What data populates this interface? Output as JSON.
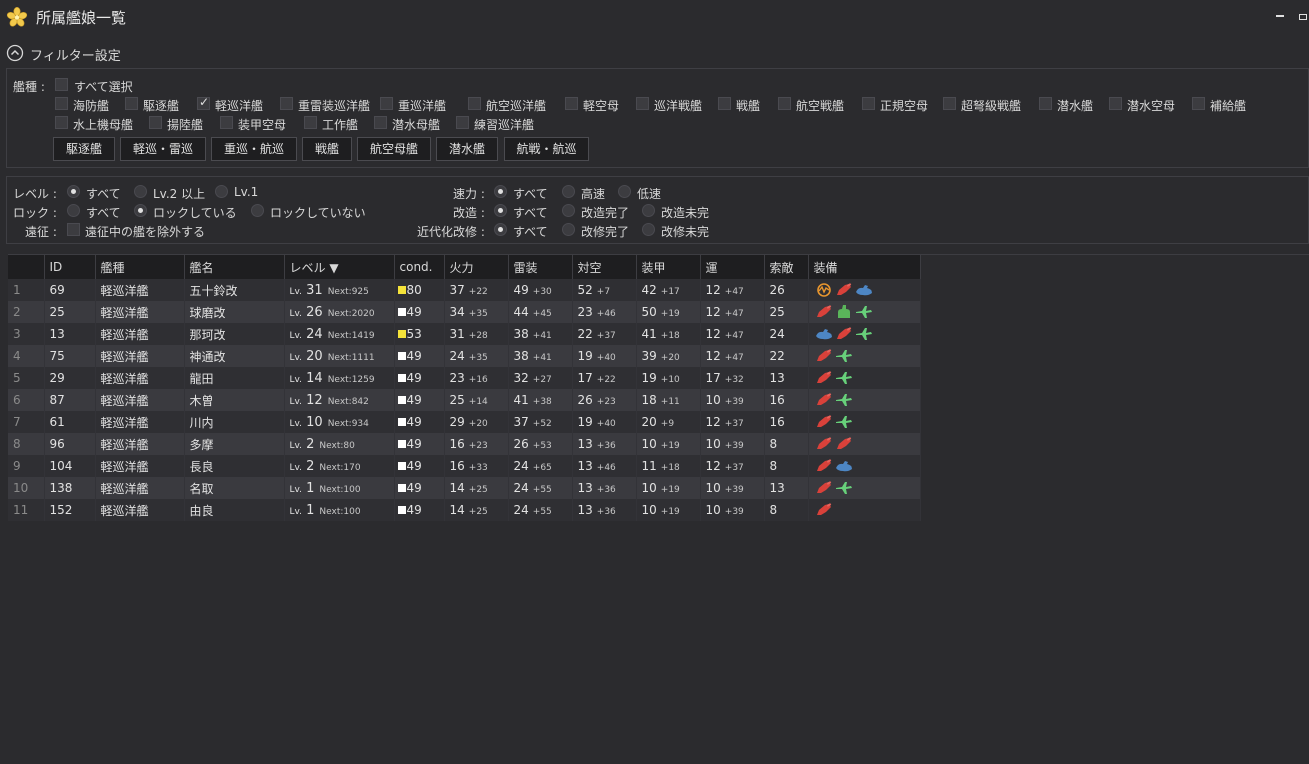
{
  "window": {
    "title": "所属艦娘一覧"
  },
  "filter": {
    "header": "フィルター設定",
    "type_label": "艦種 :",
    "select_all": "すべて選択",
    "types_row1": [
      "海防艦",
      "駆逐艦",
      "軽巡洋艦",
      "重雷装巡洋艦",
      "重巡洋艦",
      "航空巡洋艦",
      "軽空母",
      "巡洋戦艦",
      "戦艦",
      "航空戦艦",
      "正規空母",
      "超弩級戦艦",
      "潜水艦",
      "潜水空母",
      "補給艦"
    ],
    "types_row1_checked": [
      false,
      false,
      true,
      false,
      false,
      false,
      false,
      false,
      false,
      false,
      false,
      false,
      false,
      false,
      false
    ],
    "types_row2": [
      "水上機母艦",
      "揚陸艦",
      "装甲空母",
      "工作艦",
      "潜水母艦",
      "練習巡洋艦"
    ],
    "quick_buttons": [
      "駆逐艦",
      "軽巡・雷巡",
      "重巡・航巡",
      "戦艦",
      "航空母艦",
      "潜水艦",
      "航戦・航巡"
    ],
    "level": {
      "label": "レベル :",
      "options": [
        "すべて",
        "Lv.2 以上",
        "Lv.1"
      ],
      "selected": 0
    },
    "lock": {
      "label": "ロック :",
      "options": [
        "すべて",
        "ロックしている",
        "ロックしていない"
      ],
      "selected": 1
    },
    "expedition": {
      "label": "遠征 :",
      "text": "遠征中の艦を除外する"
    },
    "speed": {
      "label": "速力 :",
      "options": [
        "すべて",
        "高速",
        "低速"
      ],
      "selected": 0
    },
    "remodel": {
      "label": "改造 :",
      "options": [
        "すべて",
        "改造完了",
        "改造未完"
      ],
      "selected": 0
    },
    "modernize": {
      "label": "近代化改修 :",
      "options": [
        "すべて",
        "改修完了",
        "改修未完"
      ],
      "selected": 0
    }
  },
  "table": {
    "headers": [
      "",
      "ID",
      "艦種",
      "艦名",
      "レベル ▼",
      "cond.",
      "火力",
      "雷装",
      "対空",
      "装甲",
      "運",
      "索敵",
      "装備"
    ],
    "lv_prefix": "Lv.",
    "next_prefix": "Next:",
    "rows": [
      {
        "no": "1",
        "id": "69",
        "type": "軽巡洋艦",
        "name": "五十鈴改",
        "lv": "31",
        "next": "925",
        "cond": "80",
        "cond_color": "#f5e33a",
        "fire": "37",
        "fire_p": "+22",
        "torp": "49",
        "torp_p": "+30",
        "aa": "52",
        "aa_p": "+7",
        "armor": "42",
        "armor_p": "+17",
        "luck": "12",
        "luck_p": "+47",
        "los": "26",
        "equip": [
          "radar-icon",
          "gun-red-icon",
          "sonar-blue-icon"
        ]
      },
      {
        "no": "2",
        "id": "25",
        "type": "軽巡洋艦",
        "name": "球磨改",
        "lv": "26",
        "next": "2020",
        "cond": "49",
        "cond_color": "#ffffff",
        "fire": "34",
        "fire_p": "+35",
        "torp": "44",
        "torp_p": "+45",
        "aa": "23",
        "aa_p": "+46",
        "armor": "50",
        "armor_p": "+19",
        "luck": "12",
        "luck_p": "+47",
        "los": "25",
        "equip": [
          "gun-red-icon",
          "gun-green-icon",
          "seaplane-green-icon"
        ]
      },
      {
        "no": "3",
        "id": "13",
        "type": "軽巡洋艦",
        "name": "那珂改",
        "lv": "24",
        "next": "1419",
        "cond": "53",
        "cond_color": "#f5e33a",
        "fire": "31",
        "fire_p": "+28",
        "torp": "38",
        "torp_p": "+41",
        "aa": "22",
        "aa_p": "+37",
        "armor": "41",
        "armor_p": "+18",
        "luck": "12",
        "luck_p": "+47",
        "los": "24",
        "equip": [
          "sonar-blue-icon",
          "gun-red-icon",
          "seaplane-green-icon"
        ]
      },
      {
        "no": "4",
        "id": "75",
        "type": "軽巡洋艦",
        "name": "神通改",
        "lv": "20",
        "next": "1111",
        "cond": "49",
        "cond_color": "#ffffff",
        "fire": "24",
        "fire_p": "+35",
        "torp": "38",
        "torp_p": "+41",
        "aa": "19",
        "aa_p": "+40",
        "armor": "39",
        "armor_p": "+20",
        "luck": "12",
        "luck_p": "+47",
        "los": "22",
        "equip": [
          "gun-red-icon",
          "seaplane-green-icon"
        ]
      },
      {
        "no": "5",
        "id": "29",
        "type": "軽巡洋艦",
        "name": "龍田",
        "lv": "14",
        "next": "1259",
        "cond": "49",
        "cond_color": "#ffffff",
        "fire": "23",
        "fire_p": "+16",
        "torp": "32",
        "torp_p": "+27",
        "aa": "17",
        "aa_p": "+22",
        "armor": "19",
        "armor_p": "+10",
        "luck": "17",
        "luck_p": "+32",
        "los": "13",
        "equip": [
          "gun-red-icon",
          "seaplane-green-icon"
        ]
      },
      {
        "no": "6",
        "id": "87",
        "type": "軽巡洋艦",
        "name": "木曽",
        "lv": "12",
        "next": "842",
        "cond": "49",
        "cond_color": "#ffffff",
        "fire": "25",
        "fire_p": "+14",
        "torp": "41",
        "torp_p": "+38",
        "aa": "26",
        "aa_p": "+23",
        "armor": "18",
        "armor_p": "+11",
        "luck": "10",
        "luck_p": "+39",
        "los": "16",
        "equip": [
          "gun-red-icon",
          "seaplane-green-icon"
        ]
      },
      {
        "no": "7",
        "id": "61",
        "type": "軽巡洋艦",
        "name": "川内",
        "lv": "10",
        "next": "934",
        "cond": "49",
        "cond_color": "#ffffff",
        "fire": "29",
        "fire_p": "+20",
        "torp": "37",
        "torp_p": "+52",
        "aa": "19",
        "aa_p": "+40",
        "armor": "20",
        "armor_p": "+9",
        "luck": "12",
        "luck_p": "+37",
        "los": "16",
        "equip": [
          "gun-red-icon",
          "seaplane-green-icon"
        ]
      },
      {
        "no": "8",
        "id": "96",
        "type": "軽巡洋艦",
        "name": "多摩",
        "lv": "2",
        "next": "80",
        "cond": "49",
        "cond_color": "#ffffff",
        "fire": "16",
        "fire_p": "+23",
        "torp": "26",
        "torp_p": "+53",
        "aa": "13",
        "aa_p": "+36",
        "armor": "10",
        "armor_p": "+19",
        "luck": "10",
        "luck_p": "+39",
        "los": "8",
        "equip": [
          "gun-red-icon",
          "gun-red-icon"
        ]
      },
      {
        "no": "9",
        "id": "104",
        "type": "軽巡洋艦",
        "name": "長良",
        "lv": "2",
        "next": "170",
        "cond": "49",
        "cond_color": "#ffffff",
        "fire": "16",
        "fire_p": "+33",
        "torp": "24",
        "torp_p": "+65",
        "aa": "13",
        "aa_p": "+46",
        "armor": "11",
        "armor_p": "+18",
        "luck": "12",
        "luck_p": "+37",
        "los": "8",
        "equip": [
          "gun-red-icon",
          "sonar-blue-icon"
        ]
      },
      {
        "no": "10",
        "id": "138",
        "type": "軽巡洋艦",
        "name": "名取",
        "lv": "1",
        "next": "100",
        "cond": "49",
        "cond_color": "#ffffff",
        "fire": "14",
        "fire_p": "+25",
        "torp": "24",
        "torp_p": "+55",
        "aa": "13",
        "aa_p": "+36",
        "armor": "10",
        "armor_p": "+19",
        "luck": "10",
        "luck_p": "+39",
        "los": "13",
        "equip": [
          "gun-red-icon",
          "seaplane-green-icon"
        ]
      },
      {
        "no": "11",
        "id": "152",
        "type": "軽巡洋艦",
        "name": "由良",
        "lv": "1",
        "next": "100",
        "cond": "49",
        "cond_color": "#ffffff",
        "fire": "14",
        "fire_p": "+25",
        "torp": "24",
        "torp_p": "+55",
        "aa": "13",
        "aa_p": "+36",
        "armor": "10",
        "armor_p": "+19",
        "luck": "10",
        "luck_p": "+39",
        "los": "8",
        "equip": [
          "gun-red-icon"
        ]
      }
    ]
  }
}
